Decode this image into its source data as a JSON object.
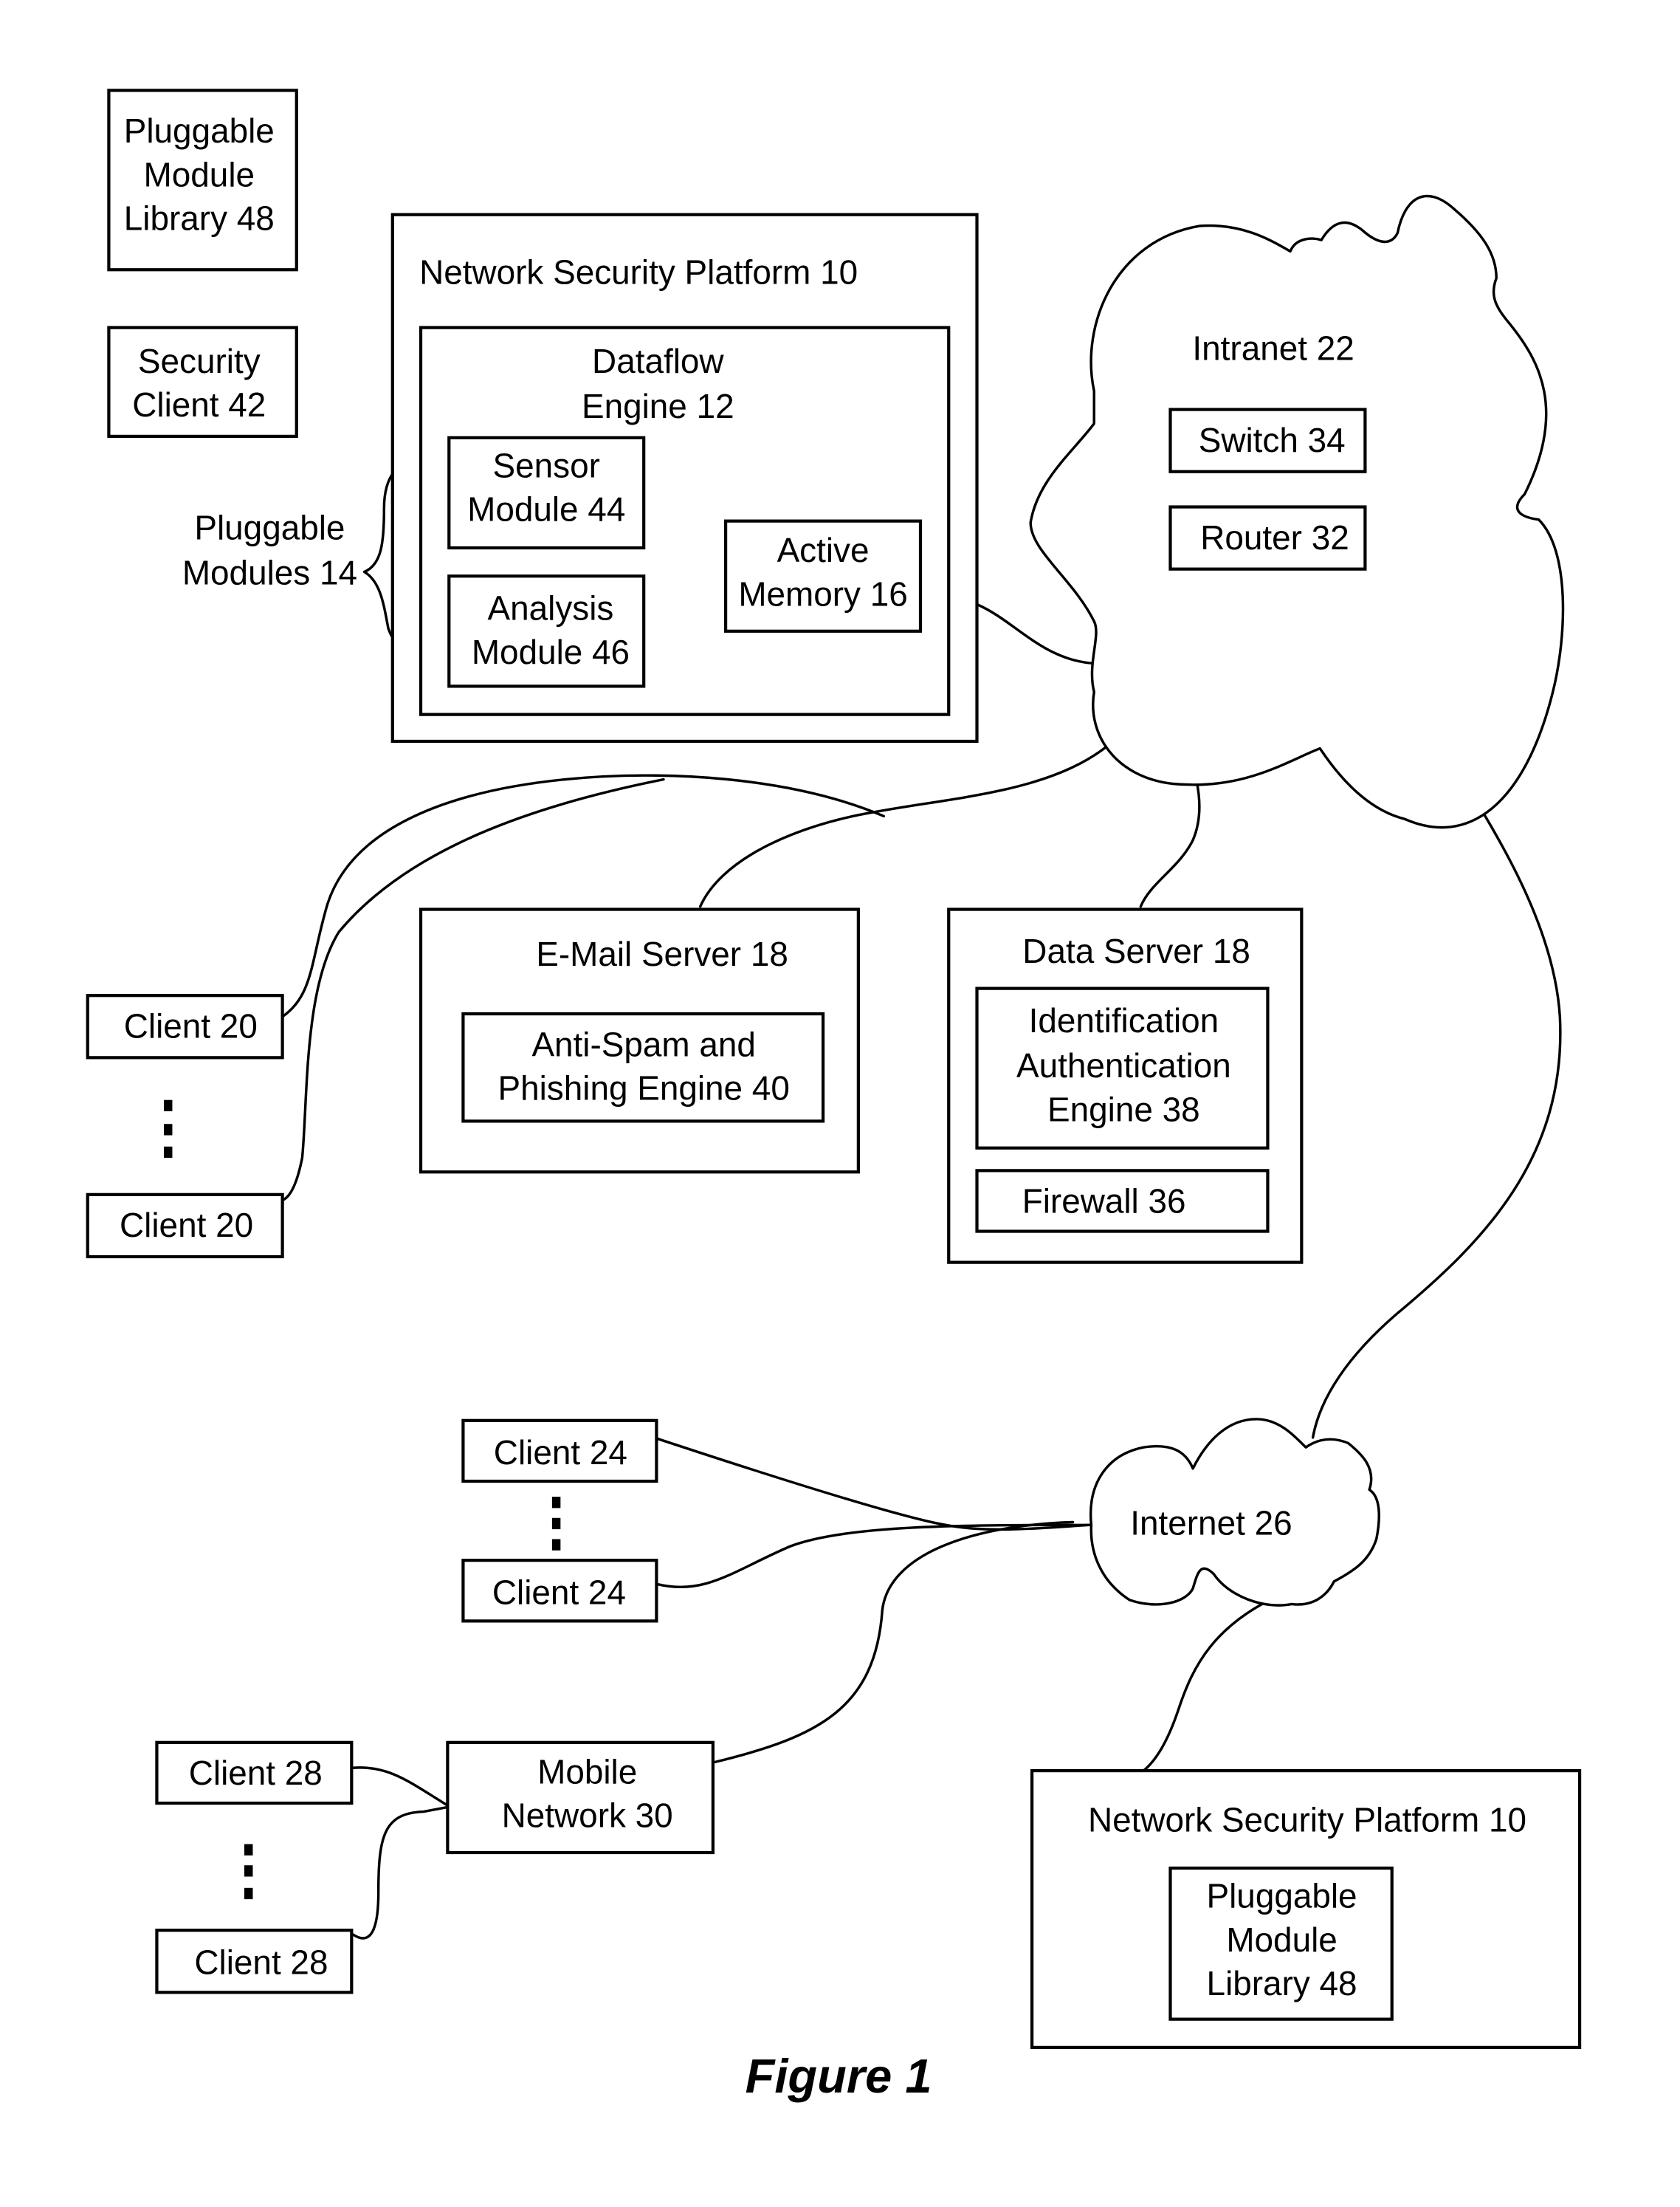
{
  "figure": {
    "caption": "Figure 1"
  },
  "components": {
    "pluggable_module_library_top": [
      "Pluggable",
      "Module",
      "Library 48"
    ],
    "security_client": [
      "Security",
      "Client 42"
    ],
    "pluggable_modules_label": [
      "Pluggable",
      "Modules 14"
    ],
    "network_security_platform_top": {
      "title": "Network Security Platform 10",
      "dataflow_engine": {
        "title": [
          "Dataflow",
          "Engine 12"
        ],
        "sensor_module": [
          "Sensor",
          "Module 44"
        ],
        "analysis_module": [
          "Analysis",
          "Module 46"
        ],
        "active_memory": [
          "Active",
          "Memory 16"
        ]
      }
    },
    "intranet": {
      "title": "Intranet 22",
      "switch": "Switch 34",
      "router": "Router 32"
    },
    "client_20_top": "Client 20",
    "client_20_bottom": "Client 20",
    "email_server": {
      "title": "E-Mail Server 18",
      "engine": [
        "Anti-Spam and",
        "Phishing Engine 40"
      ]
    },
    "data_server": {
      "title": "Data Server 18",
      "id_auth_engine": [
        "Identification",
        "Authentication",
        "Engine 38"
      ],
      "firewall": "Firewall 36"
    },
    "client_24_top": "Client 24",
    "client_24_bottom": "Client 24",
    "internet": {
      "title": "Internet 26"
    },
    "client_28_top": "Client 28",
    "client_28_bottom": "Client 28",
    "mobile_network": [
      "Mobile",
      "Network 30"
    ],
    "network_security_platform_bottom": {
      "title": "Network Security Platform 10",
      "library": [
        "Pluggable",
        "Module",
        "Library 48"
      ]
    }
  }
}
